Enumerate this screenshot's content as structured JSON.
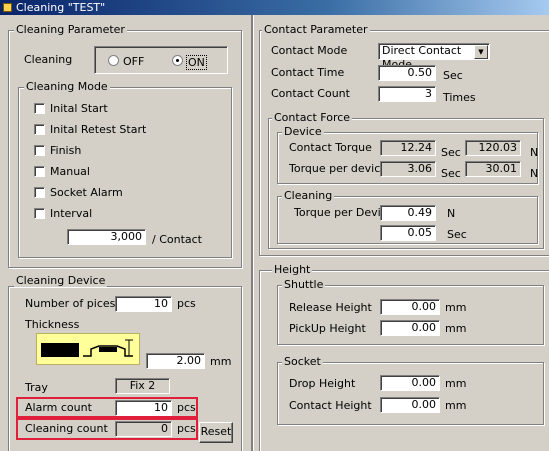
{
  "window": {
    "title": "Cleaning \"TEST\""
  },
  "cleaning_parameter": {
    "title": "Cleaning Parameter",
    "cleaning_label": "Cleaning",
    "off_label": "OFF",
    "on_label": "ON",
    "selected": "ON",
    "mode": {
      "title": "Cleaning Mode",
      "items": [
        {
          "label": "Inital Start",
          "checked": false
        },
        {
          "label": "Inital Retest Start",
          "checked": false
        },
        {
          "label": "Finish",
          "checked": false
        },
        {
          "label": "Manual",
          "checked": false
        },
        {
          "label": "Socket Alarm",
          "checked": false
        },
        {
          "label": "Interval",
          "checked": false
        }
      ],
      "interval_value": "3,000",
      "interval_unit": "/ Contact"
    }
  },
  "cleaning_device": {
    "title": "Cleaning Device",
    "num_pieces_label": "Number of pices",
    "num_pieces_value": "10",
    "num_pieces_unit": "pcs",
    "thickness_label": "Thickness",
    "thickness_value": "2.00",
    "thickness_unit": "mm",
    "tray_label": "Tray",
    "tray_value": "Fix 2",
    "alarm_label": "Alarm count",
    "alarm_value": "10",
    "alarm_unit": "pcs",
    "cleaning_count_label": "Cleaning count",
    "cleaning_count_value": "0",
    "cleaning_count_unit": "pcs",
    "reset_label": "Reset",
    "highlight_color": "#e0203a"
  },
  "contact_parameter": {
    "title": "Contact Parameter",
    "mode_label": "Contact Mode",
    "mode_value": "Direct Contact Mode",
    "time_label": "Contact Time",
    "time_value": "0.50",
    "time_unit": "Sec",
    "count_label": "Contact Count",
    "count_value": "3",
    "count_unit": "Times",
    "force": {
      "title": "Contact Force",
      "device": {
        "title": "Device",
        "torque_label": "Contact Torque",
        "torque_value1": "12.24",
        "torque_unit1": "Sec",
        "torque_value2": "120.03",
        "torque_unit2": "N",
        "per_device_label": "Torque per device",
        "per_device_value1": "3.06",
        "per_device_unit1": "Sec",
        "per_device_value2": "30.01",
        "per_device_unit2": "N"
      },
      "cleaning": {
        "title": "Cleaning",
        "torque_label": "Torque per Device",
        "torque_value": "0.49",
        "torque_unit": "N",
        "second_value": "0.05",
        "second_unit": "Sec"
      }
    }
  },
  "height": {
    "title": "Height",
    "shuttle": {
      "title": "Shuttle",
      "release_label": "Release Height",
      "release_value": "0.00",
      "release_unit": "mm",
      "pickup_label": "PickUp Height",
      "pickup_value": "0.00",
      "pickup_unit": "mm"
    },
    "socket": {
      "title": "Socket",
      "drop_label": "Drop Height",
      "drop_value": "0.00",
      "drop_unit": "mm",
      "contact_label": "Contact Height",
      "contact_value": "0.00",
      "contact_unit": "mm"
    }
  }
}
